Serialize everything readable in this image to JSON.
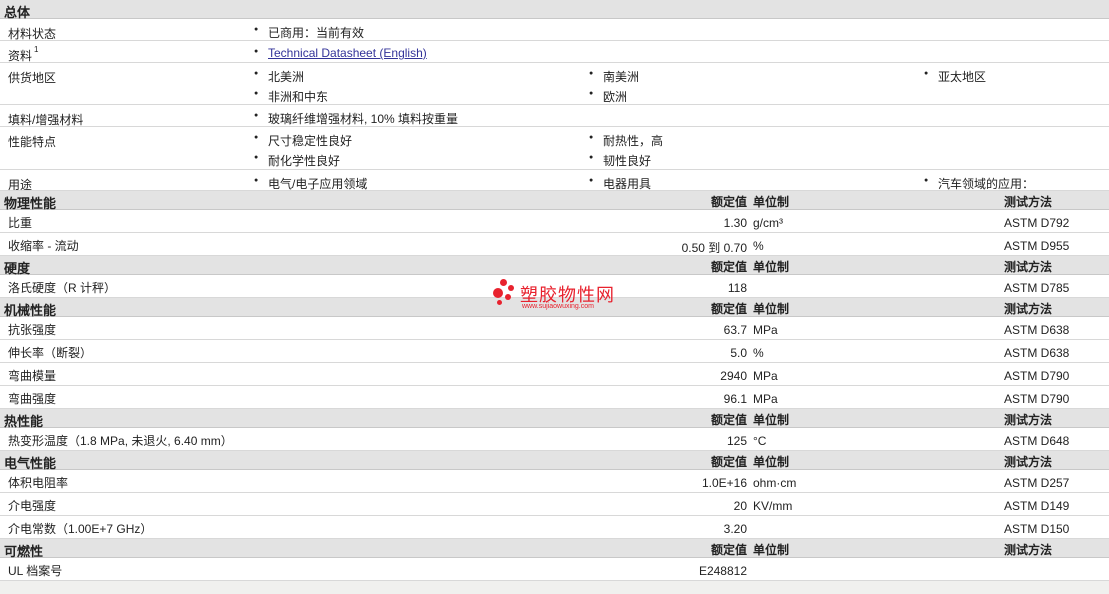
{
  "general": {
    "title": "总体",
    "status": {
      "label": "材料状态",
      "value": "已商用：当前有效"
    },
    "docs": {
      "label": "资料",
      "sup": "1",
      "link": "Technical Datasheet (English)"
    },
    "regions": {
      "label": "供货地区",
      "items": [
        "北美洲",
        "南美洲",
        "亚太地区",
        "非洲和中东",
        "欧洲"
      ]
    },
    "filler": {
      "label": "填料/增强材料",
      "value": "玻璃纤维增强材料, 10% 填料按重量"
    },
    "features": {
      "label": "性能特点",
      "items": [
        "尺寸稳定性良好",
        "耐热性，高",
        "耐化学性良好",
        "韧性良好"
      ]
    },
    "uses": {
      "label": "用途",
      "items": [
        "电气/电子应用领域",
        "电器用具",
        "汽车领域的应用："
      ]
    }
  },
  "columns": {
    "value": "额定值",
    "unit": "单位制",
    "test": "测试方法"
  },
  "sections": [
    {
      "title": "物理性能",
      "rows": [
        {
          "name": "比重",
          "value": "1.30",
          "unit": "g/cm³",
          "test": "ASTM D792"
        },
        {
          "name": "收缩率  - 流动",
          "value": "0.50 到  0.70",
          "unit": "%",
          "test": "ASTM D955"
        }
      ]
    },
    {
      "title": "硬度",
      "rows": [
        {
          "name": "洛氏硬度（R 计秤）",
          "value": "118",
          "unit": "",
          "test": "ASTM D785"
        }
      ]
    },
    {
      "title": "机械性能",
      "rows": [
        {
          "name": "抗张强度",
          "value": "63.7",
          "unit": "MPa",
          "test": "ASTM D638"
        },
        {
          "name": "伸长率（断裂）",
          "value": "5.0",
          "unit": "%",
          "test": "ASTM D638"
        },
        {
          "name": "弯曲模量",
          "value": "2940",
          "unit": "MPa",
          "test": "ASTM D790"
        },
        {
          "name": "弯曲强度",
          "value": "96.1",
          "unit": "MPa",
          "test": "ASTM D790"
        }
      ]
    },
    {
      "title": "热性能",
      "rows": [
        {
          "name": "热变形温度（1.8 MPa, 未退火, 6.40 mm）",
          "value": "125",
          "unit": "°C",
          "test": "ASTM D648"
        }
      ]
    },
    {
      "title": "电气性能",
      "rows": [
        {
          "name": "体积电阻率",
          "value": "1.0E+16",
          "unit": "ohm·cm",
          "test": "ASTM D257"
        },
        {
          "name": "介电强度",
          "value": "20",
          "unit": "KV/mm",
          "test": "ASTM D149"
        },
        {
          "name": "介电常数（1.00E+7 GHz）",
          "value": "3.20",
          "unit": "",
          "test": "ASTM D150"
        }
      ]
    },
    {
      "title": "可燃性",
      "rows": [
        {
          "name": "UL 档案号",
          "value": "E248812",
          "unit": "",
          "test": ""
        }
      ]
    }
  ],
  "watermark": {
    "text": "塑胶物性网",
    "url": "www.sujiaowuxing.com",
    "color": "#e8222e"
  }
}
